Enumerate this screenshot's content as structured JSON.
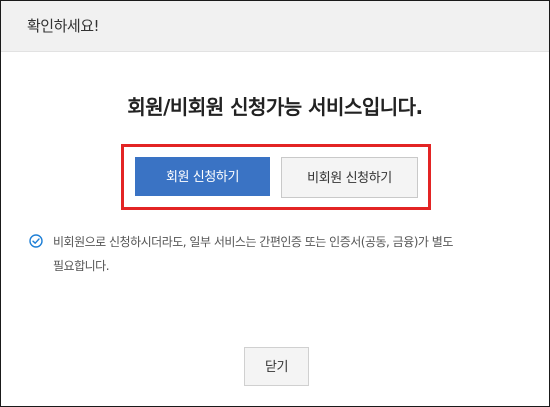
{
  "modal": {
    "title": "확인하세요!",
    "headline": "회원/비회원 신청가능 서비스입니다.",
    "buttons": {
      "member_label": "회원 신청하기",
      "nonmember_label": "비회원 신청하기",
      "close_label": "닫기"
    },
    "notice": {
      "icon": "check-circle-icon",
      "line1": "비회원으로 신청하시더라도, 일부 서비스는 간편인증 또는 인증서(공동, 금융)가 별도",
      "line2": "필요합니다."
    }
  },
  "colors": {
    "header_bg": "#f1f1f1",
    "primary_button": "#3a73c4",
    "highlight_border": "#e32424",
    "icon": "#1e7fd6"
  }
}
